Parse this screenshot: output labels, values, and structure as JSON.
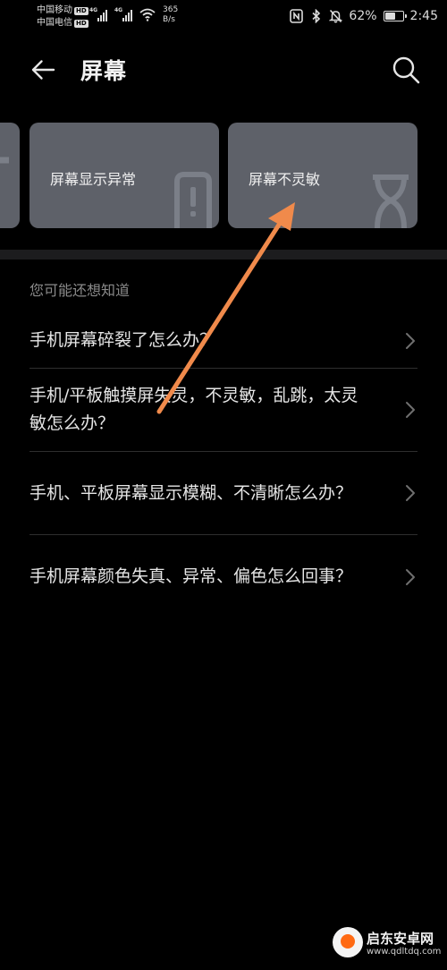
{
  "status_bar": {
    "carrier_1": "中国移动",
    "carrier_2": "中国电信",
    "hd_badge": "HD",
    "network_1": "4G",
    "network_2": "4G",
    "speed_value": "365",
    "speed_unit": "B/s",
    "battery_percent": "62%",
    "battery_level": 0.62,
    "time": "2:45"
  },
  "header": {
    "title": "屏幕"
  },
  "cards": [
    {
      "label": ""
    },
    {
      "label": "屏幕显示异常",
      "icon": "phone-alert-icon"
    },
    {
      "label": "屏幕不灵敏",
      "icon": "hourglass-icon"
    }
  ],
  "faq": {
    "heading": "您可能还想知道",
    "items": [
      {
        "text": "手机屏幕碎裂了怎么办？"
      },
      {
        "text": "手机/平板触摸屏失灵，不灵敏，乱跳，太灵敏怎么办？"
      },
      {
        "text": "手机、平板屏幕显示模糊、不清晰怎么办？"
      },
      {
        "text": "手机屏幕颜色失真、异常、偏色怎么回事？"
      }
    ]
  },
  "watermark": {
    "name": "启东安卓网",
    "url": "www.qdltdq.com"
  },
  "colors": {
    "background": "#000000",
    "card": "#5e6169",
    "annotation_arrow": "#f08a4b",
    "text_primary": "#e6e6e6",
    "text_secondary": "#8a8a8a"
  }
}
